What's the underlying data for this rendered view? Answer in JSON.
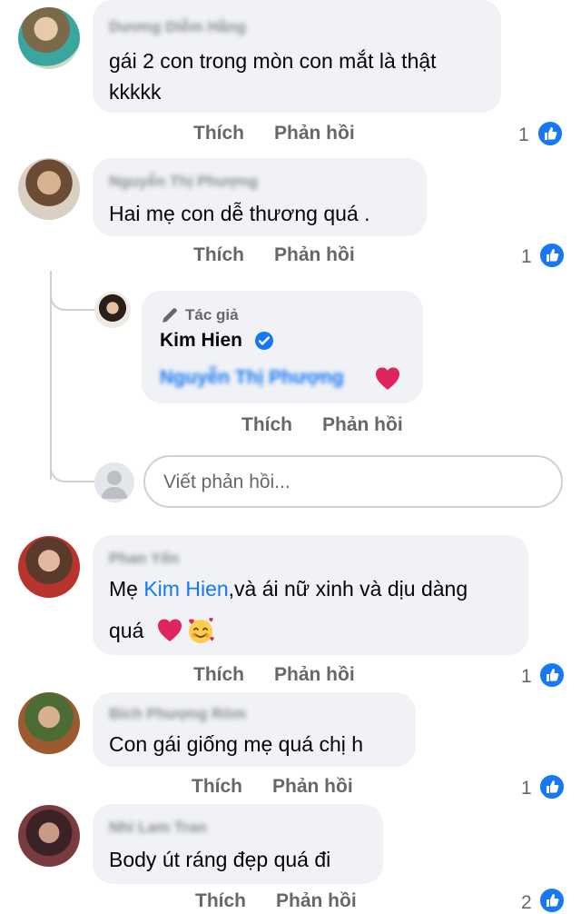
{
  "actions": {
    "like": "Thích",
    "reply": "Phản hồi"
  },
  "colors": {
    "link": "#1877f2",
    "bubble": "#f0f2f5",
    "heart": "#e0245e",
    "muted": "#65676b"
  },
  "comments": [
    {
      "name": "Dương Diễm Hằng",
      "line1": "gái 2 con trong mòn con mắt là thật",
      "line2": "kkkkk",
      "likes": "1"
    },
    {
      "name": "Nguyễn Thị Phượng",
      "line1": "Hai mẹ con dễ thương quá .",
      "likes": "1"
    },
    {
      "name": "Phan Yến",
      "line1_prefix": "Mẹ ",
      "mention": "Kim Hien",
      "line1_suffix": ",và ái nữ xinh và dịu dàng",
      "line2": "quá",
      "likes": "1"
    },
    {
      "name": "Bích Phượng Ròm",
      "line1": "Con gái giống mẹ quá chị h",
      "likes": "1"
    },
    {
      "name": "Nhi Lam Tran",
      "line1": "Body út ráng đẹp quá đi",
      "likes": "2"
    }
  ],
  "reply": {
    "badge": "Tác giả",
    "name": "Kim Hien",
    "mention": "Nguyễn Thị Phượng",
    "icons": [
      "pen-icon",
      "verified-badge-icon",
      "heart-icon"
    ]
  },
  "composer": {
    "placeholder": "Viết phản hồi..."
  }
}
